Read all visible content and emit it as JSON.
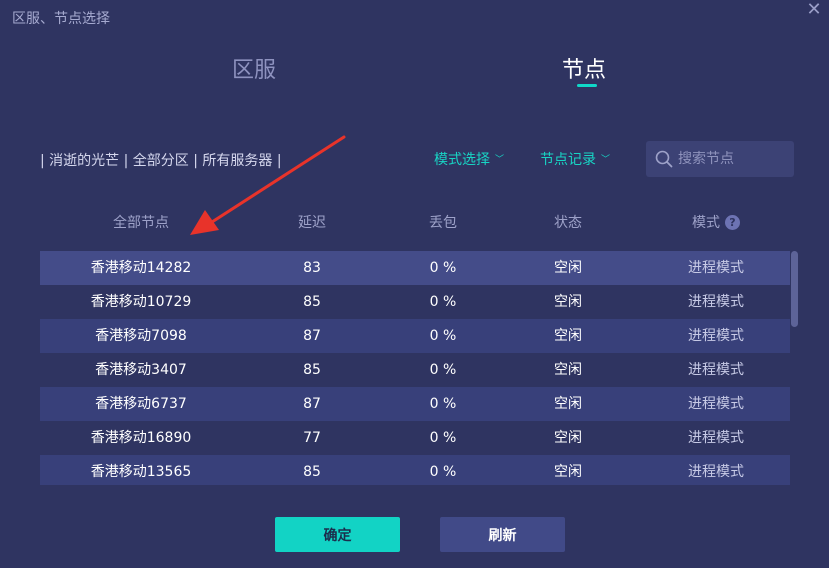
{
  "window": {
    "title": "区服、节点选择"
  },
  "tabs": [
    {
      "label": "区服",
      "active": false
    },
    {
      "label": "节点",
      "active": true
    }
  ],
  "breadcrumb": "| 消逝的光芒 | 全部分区 | 所有服务器 |",
  "filters": {
    "mode_label": "模式选择",
    "record_label": "节点记录"
  },
  "search": {
    "placeholder": "搜索节点",
    "value": ""
  },
  "table": {
    "columns": [
      "全部节点",
      "延迟",
      "丢包",
      "状态",
      "模式"
    ],
    "rows": [
      [
        "香港移动14282",
        "83",
        "0 %",
        "空闲",
        "进程模式"
      ],
      [
        "香港移动10729",
        "85",
        "0 %",
        "空闲",
        "进程模式"
      ],
      [
        "香港移动7098",
        "87",
        "0 %",
        "空闲",
        "进程模式"
      ],
      [
        "香港移动3407",
        "85",
        "0 %",
        "空闲",
        "进程模式"
      ],
      [
        "香港移动6737",
        "87",
        "0 %",
        "空闲",
        "进程模式"
      ],
      [
        "香港移动16890",
        "77",
        "0 %",
        "空闲",
        "进程模式"
      ],
      [
        "香港移动13565",
        "85",
        "0 %",
        "空闲",
        "进程模式"
      ]
    ],
    "selected_row": 0
  },
  "buttons": {
    "confirm": "确定",
    "refresh": "刷新"
  },
  "colors": {
    "background": "#2f3461",
    "accent": "#12d3c5",
    "row_alt": "#38407a",
    "row_selected": "#444c89",
    "annotation_arrow": "#e8332a"
  }
}
